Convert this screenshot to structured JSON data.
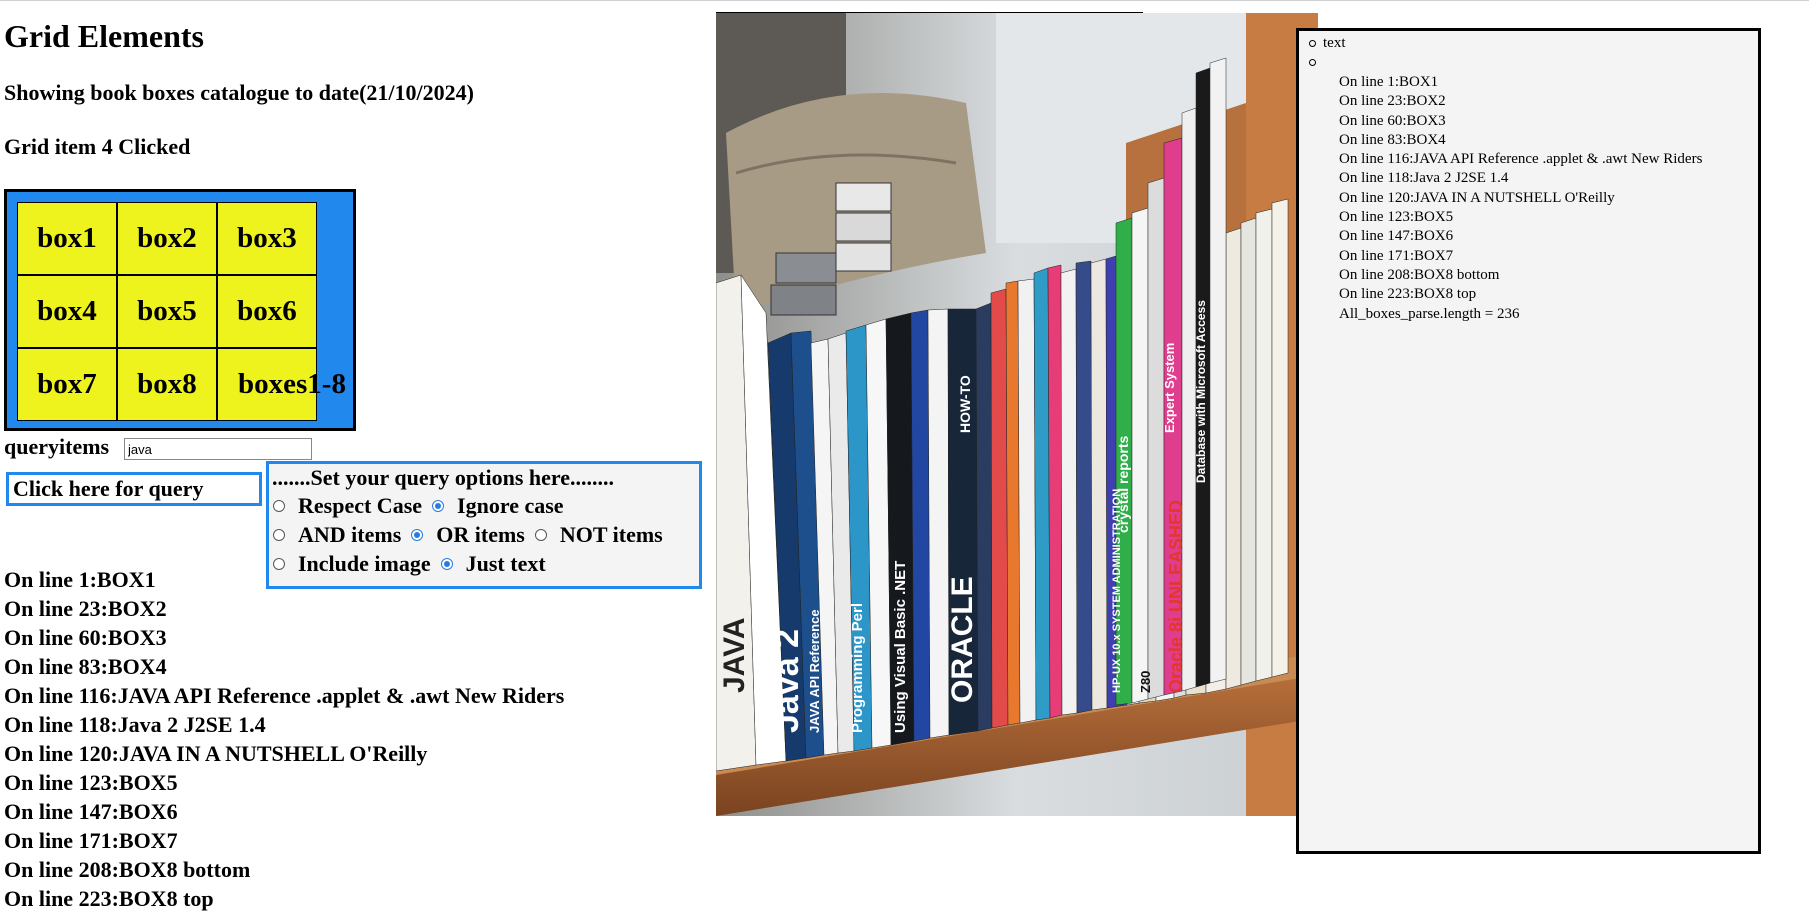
{
  "page": {
    "title": "Grid Elements",
    "subtitle": "Showing book boxes catalogue to date(21/10/2024)",
    "clicked_status": "Grid item 4 Clicked"
  },
  "grid": {
    "items": [
      "box1",
      "box2",
      "box3",
      "box4",
      "box5",
      "box6",
      "box7",
      "box8",
      "boxes1-8"
    ],
    "cell_color": "#eef21d",
    "background_color": "#2188ee"
  },
  "query": {
    "label": "queryitems",
    "value": "java",
    "button_label": "Click here for query"
  },
  "options": {
    "title": ".......Set your query options here........",
    "case": {
      "respect": "Respect Case",
      "ignore": "Ignore case",
      "selected": "ignore"
    },
    "logic": {
      "and": "AND items",
      "or": "OR items",
      "not": "NOT items",
      "selected": "or"
    },
    "display": {
      "image": "Include image",
      "text": "Just text",
      "selected": "text"
    }
  },
  "results": [
    "On line 1:BOX1",
    "On line 23:BOX2",
    "On line 60:BOX3",
    "On line 83:BOX4",
    "On line 116:JAVA API Reference .applet & .awt New Riders",
    "On line 118:Java 2 J2SE 1.4",
    "On line 120:JAVA IN A NUTSHELL O'Reilly",
    "On line 123:BOX5",
    "On line 147:BOX6",
    "On line 171:BOX7",
    "On line 208:BOX8 bottom",
    "On line 223:BOX8 top"
  ],
  "side_panel": {
    "bullet_text": "text",
    "lines": [
      "On line 1:BOX1",
      "On line 23:BOX2",
      "On line 60:BOX3",
      "On line 83:BOX4",
      "On line 116:JAVA API Reference .applet & .awt New Riders",
      "On line 118:Java 2 J2SE 1.4",
      "On line 120:JAVA IN A NUTSHELL O'Reilly",
      "On line 123:BOX5",
      "On line 147:BOX6",
      "On line 171:BOX7",
      "On line 208:BOX8 bottom",
      "On line 223:BOX8 top",
      "All_boxes_parse.length = 236"
    ]
  },
  "photo": {
    "book_spines": [
      "JAVA",
      "Java 2",
      "JAVA API Reference",
      "Programming Perl",
      "Using Visual Basic .NET",
      "ORACLE",
      "HOW-TO",
      "Z80",
      "HP-UX 10.x SYSTEM ADMINISTRATION",
      "Oracle 8i UNLEASHED",
      "crystal reports",
      "Expert System",
      "Database with Microsoft Access"
    ]
  }
}
